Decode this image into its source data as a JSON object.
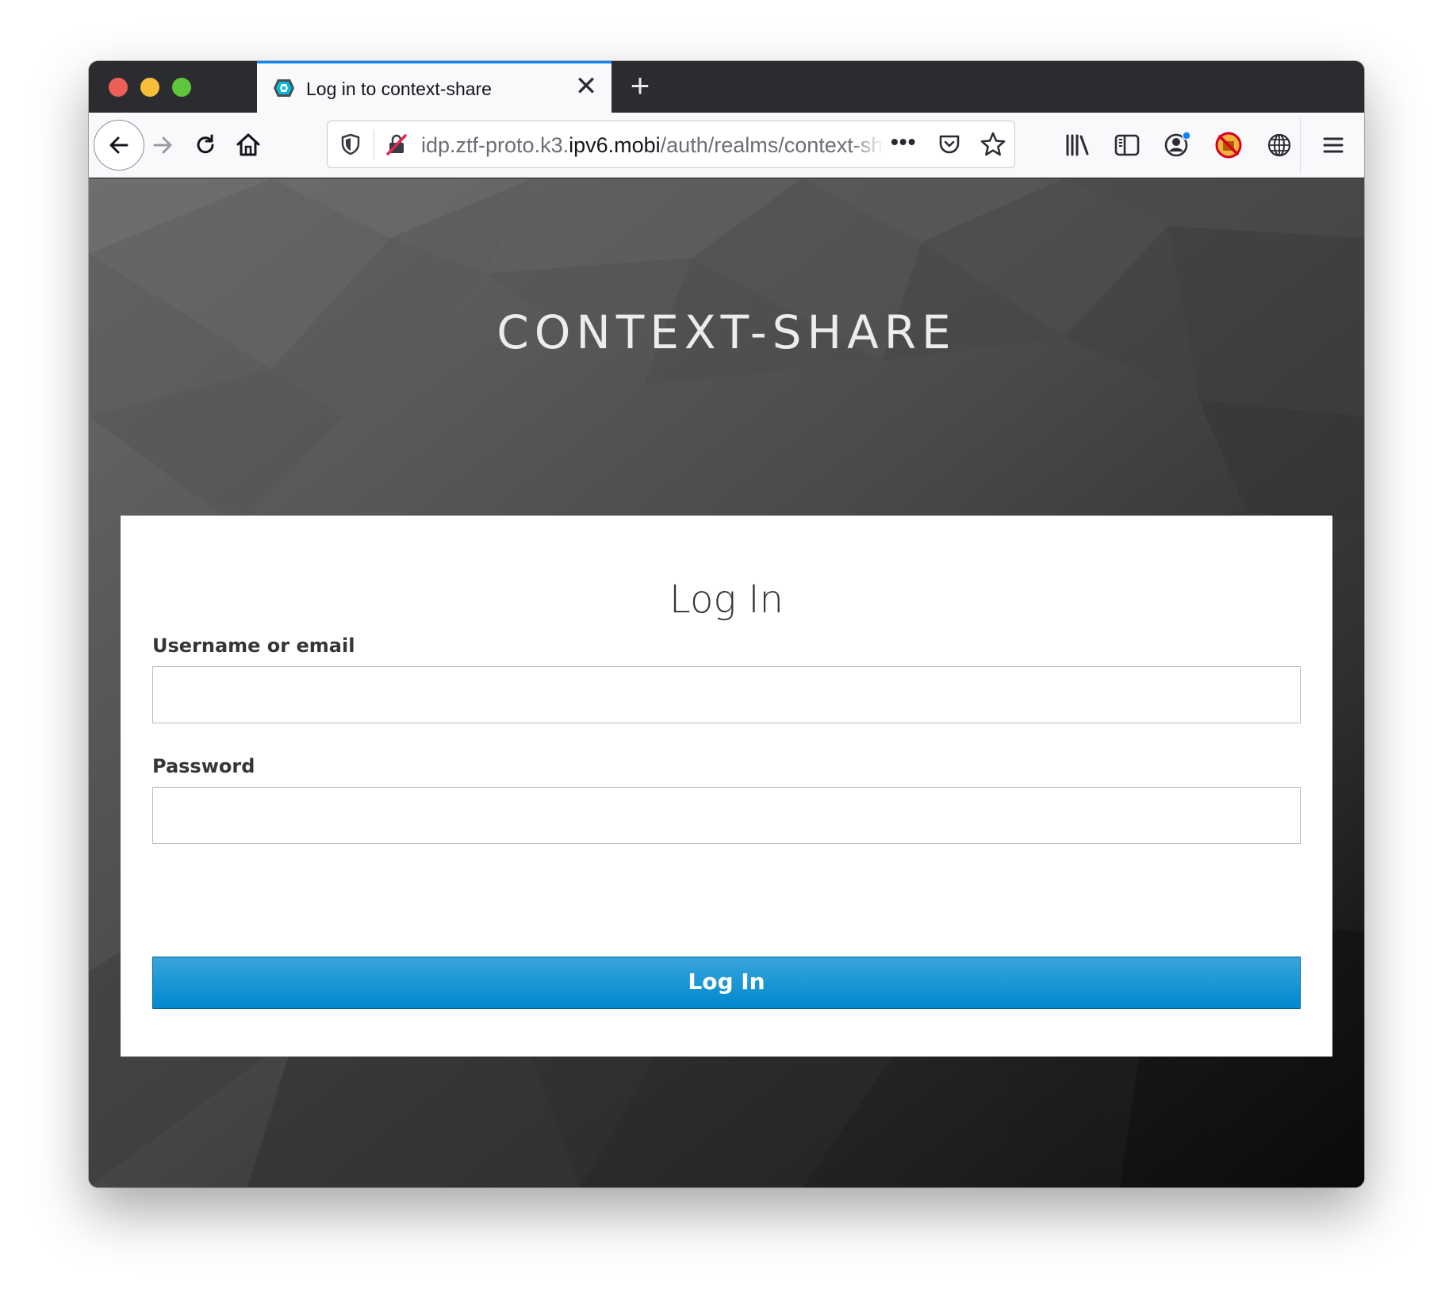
{
  "browser": {
    "tab": {
      "title": "Log in to context-share",
      "close_glyph": "✕",
      "favicon": "keycloak-icon"
    },
    "new_tab_glyph": "+",
    "url": {
      "subdomain": "idp.ztf-proto.k3.",
      "domain": "ipv6.mobi",
      "path": "/auth/realms/context-share",
      "more_glyph": "•••"
    },
    "nav_icons": [
      "back-arrow-icon",
      "forward-arrow-icon",
      "reload-icon",
      "home-icon"
    ],
    "toolbar_icons": [
      "library-icon",
      "sidebar-icon",
      "account-icon",
      "blocked-extension-icon",
      "globe-icon",
      "hamburger-menu-icon"
    ],
    "colors": {
      "accent": "#0a84ff"
    }
  },
  "page": {
    "brand": "CONTEXT-SHARE",
    "form": {
      "title": "Log In",
      "username_label": "Username or email",
      "username_value": "",
      "password_label": "Password",
      "password_value": "",
      "submit_label": "Log In"
    },
    "colors": {
      "button": "#0088ce",
      "button_top": "#39a5dc"
    }
  }
}
